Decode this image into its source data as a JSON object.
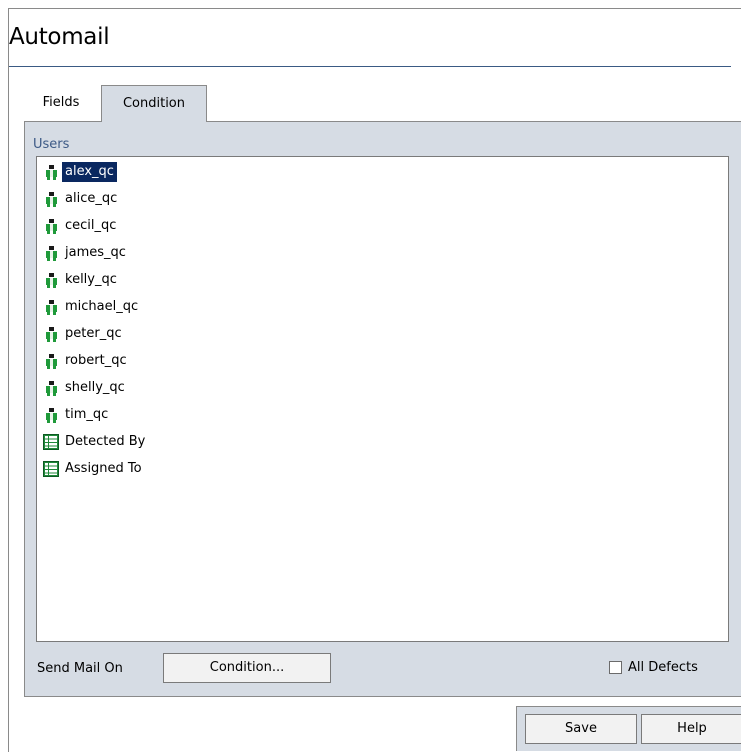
{
  "window": {
    "title": "Automail"
  },
  "tabs": [
    {
      "label": "Fields",
      "active": false
    },
    {
      "label": "Condition",
      "active": true
    }
  ],
  "users_panel": {
    "label": "Users",
    "items": [
      {
        "label": "alex_qc",
        "icon": "user-icon",
        "selected": true
      },
      {
        "label": "alice_qc",
        "icon": "user-icon"
      },
      {
        "label": "cecil_qc",
        "icon": "user-icon"
      },
      {
        "label": "james_qc",
        "icon": "user-icon"
      },
      {
        "label": "kelly_qc",
        "icon": "user-icon"
      },
      {
        "label": "michael_qc",
        "icon": "user-icon"
      },
      {
        "label": "peter_qc",
        "icon": "user-icon"
      },
      {
        "label": "robert_qc",
        "icon": "user-icon"
      },
      {
        "label": "shelly_qc",
        "icon": "user-icon"
      },
      {
        "label": "tim_qc",
        "icon": "user-icon"
      },
      {
        "label": "Detected By",
        "icon": "field-icon"
      },
      {
        "label": "Assigned To",
        "icon": "field-icon"
      }
    ]
  },
  "send_mail": {
    "label": "Send Mail On",
    "condition_button": "Condition...",
    "all_defects_label": "All Defects",
    "all_defects_checked": false
  },
  "footer": {
    "save_label": "Save",
    "help_label": "Help"
  },
  "colors": {
    "panel_bg": "#d6dce4",
    "selection_bg": "#0a2860",
    "users_label": "#3d5a86",
    "user_icon_green": "#1f9a3a"
  }
}
